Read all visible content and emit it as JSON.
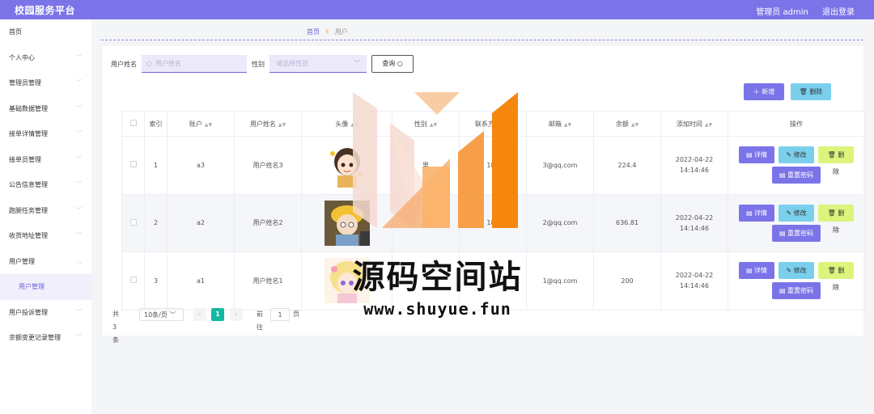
{
  "header": {
    "title": "校园服务平台",
    "user_label": "管理员 admin",
    "logout": "退出登录"
  },
  "sidebar": {
    "items": [
      {
        "label": "首页"
      },
      {
        "label": "个人中心"
      },
      {
        "label": "管理员管理"
      },
      {
        "label": "基础数据管理"
      },
      {
        "label": "接单详情管理"
      },
      {
        "label": "接单员管理"
      },
      {
        "label": "公告信息管理"
      },
      {
        "label": "跑腿任务管理"
      },
      {
        "label": "收货地址管理"
      },
      {
        "label": "用户管理"
      },
      {
        "label": "用户管理",
        "active": true
      },
      {
        "label": "用户投诉管理"
      },
      {
        "label": "余额变更记录管理"
      }
    ]
  },
  "breadcrumb": {
    "home": "首页",
    "current": "用户"
  },
  "search": {
    "name_label": "用户姓名",
    "name_placeholder": "用户姓名",
    "gender_label": "性别",
    "gender_placeholder": "请选择性别",
    "query_button": "查询"
  },
  "actions": {
    "add": "新增",
    "delete": "删除"
  },
  "table": {
    "headers": [
      "索引",
      "账户",
      "用户姓名",
      "头像",
      "性别",
      "联系方式",
      "邮箱",
      "余额",
      "添加时间",
      "操作"
    ],
    "rows": [
      {
        "index": "1",
        "account": "a3",
        "name": "用户姓名3",
        "gender": "男",
        "phone": "186",
        "email": "3@qq.com",
        "balance": "224.4",
        "created": "2022-04-22 14:14:46"
      },
      {
        "index": "2",
        "account": "a2",
        "name": "用户姓名2",
        "gender": "女",
        "phone": "186",
        "email": "2@qq.com",
        "balance": "636.81",
        "created": "2022-04-22 14:14:46"
      },
      {
        "index": "3",
        "account": "a1",
        "name": "用户姓名1",
        "gender": "",
        "phone": "",
        "email": "1@qq.com",
        "balance": "200",
        "created": "2022-04-22 14:14:46"
      }
    ],
    "ops": {
      "detail": "详情",
      "edit": "修改",
      "delete": "删除",
      "reset": "重置密码"
    }
  },
  "pagination": {
    "total": "共 3 条",
    "page_size": "10条/页",
    "current_page": "1",
    "prev": "‹",
    "next": "›",
    "goto_label": "前往",
    "goto_value": "1",
    "page_unit": "页"
  },
  "watermark": {
    "title": "源码空间站",
    "url": "www.shuyue.fun"
  },
  "colors": {
    "primary": "#7b74e8",
    "info": "#7ad0ec",
    "warning": "#dcf47c",
    "pager_active": "#13b9a0",
    "watermark_orange": "#f5870f"
  }
}
